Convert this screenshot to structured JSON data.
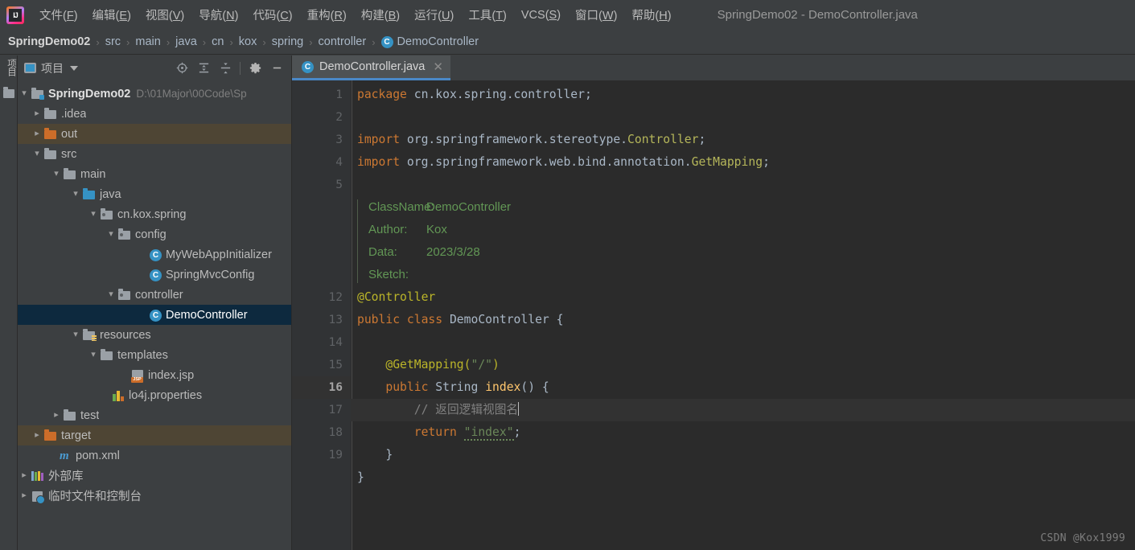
{
  "window": {
    "title": "SpringDemo02 - DemoController.java",
    "logo_icon": "intellij-idea-logo"
  },
  "menubar": {
    "items": [
      {
        "label": "文件",
        "mnemonic": "F"
      },
      {
        "label": "编辑",
        "mnemonic": "E"
      },
      {
        "label": "视图",
        "mnemonic": "V"
      },
      {
        "label": "导航",
        "mnemonic": "N"
      },
      {
        "label": "代码",
        "mnemonic": "C"
      },
      {
        "label": "重构",
        "mnemonic": "R"
      },
      {
        "label": "构建",
        "mnemonic": "B"
      },
      {
        "label": "运行",
        "mnemonic": "U"
      },
      {
        "label": "工具",
        "mnemonic": "T"
      },
      {
        "label": "VCS",
        "mnemonic": "S"
      },
      {
        "label": "窗口",
        "mnemonic": "W"
      },
      {
        "label": "帮助",
        "mnemonic": "H"
      }
    ]
  },
  "breadcrumb": {
    "separator": "›",
    "items": [
      "SpringDemo02",
      "src",
      "main",
      "java",
      "cn",
      "kox",
      "spring",
      "controller",
      "DemoController"
    ],
    "last_icon": "class-icon",
    "class_badge": "C"
  },
  "toolstrip": {
    "vertical_tab_label": "项目",
    "folder_icon": "folder-icon"
  },
  "project_panel": {
    "view_icon": "project-view-icon",
    "title": "项目",
    "dropdown_icon": "chevron-down-icon",
    "tools": [
      {
        "name": "locate-icon",
        "title": "选择打开的文件"
      },
      {
        "name": "expand-all-icon",
        "title": "全部展开"
      },
      {
        "name": "collapse-all-icon",
        "title": "全部折叠"
      },
      {
        "name": "gear-icon",
        "title": "设置"
      },
      {
        "name": "minimize-icon",
        "title": "隐藏"
      }
    ],
    "tree": [
      {
        "label": "SpringDemo02",
        "path": "D:\\01Major\\00Code\\Sp",
        "indent": 0,
        "chev": "down",
        "icon": "module-folder-icon",
        "bold": true,
        "state": "normal"
      },
      {
        "label": ".idea",
        "path": "",
        "indent": 1,
        "chev": "right",
        "icon": "folder-gray-icon",
        "bold": false,
        "state": "normal"
      },
      {
        "label": "out",
        "path": "",
        "indent": 1,
        "chev": "right",
        "icon": "folder-orange-icon",
        "bold": false,
        "state": "excluded"
      },
      {
        "label": "src",
        "path": "",
        "indent": 1,
        "chev": "down",
        "icon": "folder-gray-icon",
        "bold": false,
        "state": "normal"
      },
      {
        "label": "main",
        "path": "",
        "indent": 2,
        "chev": "down",
        "icon": "folder-gray-icon",
        "bold": false,
        "state": "normal"
      },
      {
        "label": "java",
        "path": "",
        "indent": 3,
        "chev": "down",
        "icon": "folder-blue-icon",
        "bold": false,
        "state": "normal"
      },
      {
        "label": "cn.kox.spring",
        "path": "",
        "indent": 4,
        "chev": "down",
        "icon": "package-icon",
        "bold": false,
        "state": "normal"
      },
      {
        "label": "config",
        "path": "",
        "indent": 5,
        "chev": "down",
        "icon": "package-icon",
        "bold": false,
        "state": "normal"
      },
      {
        "label": "MyWebAppInitializer",
        "path": "",
        "indent": 6,
        "chev": "none",
        "icon": "class-icon",
        "bold": false,
        "state": "normal"
      },
      {
        "label": "SpringMvcConfig",
        "path": "",
        "indent": 6,
        "chev": "none",
        "icon": "class-icon",
        "bold": false,
        "state": "normal"
      },
      {
        "label": "controller",
        "path": "",
        "indent": 5,
        "chev": "down",
        "icon": "package-icon",
        "bold": false,
        "state": "normal"
      },
      {
        "label": "DemoController",
        "path": "",
        "indent": 6,
        "chev": "none",
        "icon": "class-icon",
        "bold": false,
        "state": "selected"
      },
      {
        "label": "resources",
        "path": "",
        "indent": 3,
        "chev": "down",
        "icon": "resources-folder-icon",
        "bold": false,
        "state": "normal"
      },
      {
        "label": "templates",
        "path": "",
        "indent": 4,
        "chev": "down",
        "icon": "folder-gray-icon",
        "bold": false,
        "state": "normal"
      },
      {
        "label": "index.jsp",
        "path": "",
        "indent": 5,
        "chev": "none",
        "icon": "jsp-file-icon",
        "bold": false,
        "state": "normal"
      },
      {
        "label": "lo4j.properties",
        "path": "",
        "indent": 4,
        "chev": "none",
        "icon": "properties-file-icon",
        "bold": false,
        "state": "normal"
      },
      {
        "label": "test",
        "path": "",
        "indent": 2,
        "chev": "right",
        "icon": "folder-gray-icon",
        "bold": false,
        "state": "normal"
      },
      {
        "label": "target",
        "path": "",
        "indent": 1,
        "chev": "right",
        "icon": "folder-orange-icon",
        "bold": false,
        "state": "excluded"
      },
      {
        "label": "pom.xml",
        "path": "",
        "indent": 1,
        "chev": "none",
        "icon": "maven-file-icon",
        "bold": false,
        "state": "normal"
      },
      {
        "label": "外部库",
        "path": "",
        "indent": 0,
        "chev": "right",
        "icon": "external-libraries-icon",
        "bold": false,
        "state": "normal"
      },
      {
        "label": "临时文件和控制台",
        "path": "",
        "indent": 0,
        "chev": "right",
        "icon": "scratches-icon",
        "bold": false,
        "state": "normal"
      }
    ]
  },
  "editor": {
    "tab": {
      "label": "DemoController.java",
      "icon": "class-icon",
      "badge": "C",
      "close_icon": "close-icon"
    },
    "gutter": {
      "line_numbers": [
        "1",
        "2",
        "3",
        "4",
        "5",
        "12",
        "13",
        "14",
        "15",
        "16",
        "17",
        "18",
        "19"
      ],
      "current_line": "16",
      "bean_icon_line": "13",
      "bean_icon": "spring-bean-icon"
    },
    "doc_comment": {
      "rows": [
        {
          "key": "ClassName:",
          "value": "DemoController"
        },
        {
          "key": "Author:",
          "value": "Kox"
        },
        {
          "key": "Data:",
          "value": "2023/3/28"
        },
        {
          "key": "Sketch:",
          "value": ""
        }
      ]
    },
    "code": {
      "l1_kw": "package",
      "l1_rest": " cn.kox.spring.controller;",
      "l3_kw": "import",
      "l3_pkg": " org.springframework.stereotype.",
      "l3_cls": "Controller",
      "l3_end": ";",
      "l4_kw": "import",
      "l4_pkg": " org.springframework.web.bind.annotation.",
      "l4_cls": "GetMapping",
      "l4_end": ";",
      "l12_ann": "@Controller",
      "l13_kw1": "public",
      "l13_kw2": "class",
      "l13_name": " DemoController ",
      "l13_brace": "{",
      "l14_ann": "@GetMapping(",
      "l14_str": "\"/\"",
      "l14_close": ")",
      "l15_kw": "public",
      "l15_type": " String ",
      "l15_fn": "index",
      "l15_rest": "() {",
      "l16_cmt": "// 返回逻辑视图名",
      "l17_kw": "return",
      "l17_str": "\"index\"",
      "l17_end": ";",
      "l18_brace": "}",
      "l19_brace": "}"
    }
  },
  "watermark": "CSDN @Kox1999",
  "colors": {
    "chrome_bg": "#3c3f41",
    "editor_bg": "#2b2b2b",
    "gutter_bg": "#313335",
    "selection": "#0d293e",
    "excluded": "#4e4534",
    "accent": "#3592c4",
    "keyword": "#cc7832",
    "annotation": "#bbb529",
    "string": "#6a8759",
    "comment": "#808080",
    "doc_comment": "#629755",
    "method": "#ffc66d",
    "text": "#a9b7c6"
  }
}
